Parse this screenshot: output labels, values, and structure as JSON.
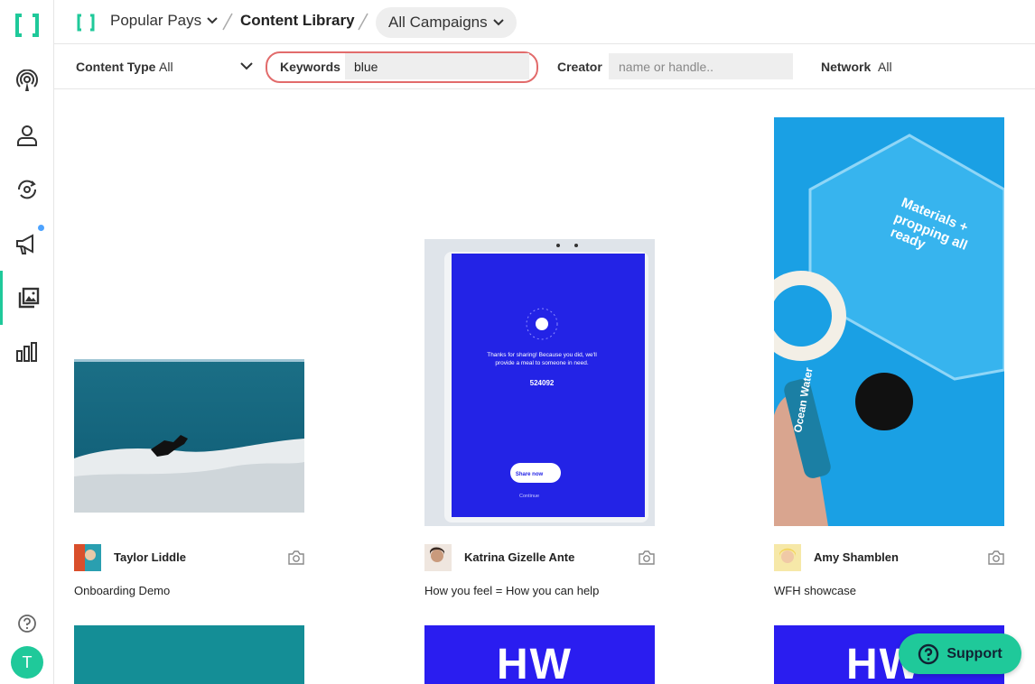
{
  "breadcrumb": {
    "org": "Popular Pays",
    "page": "Content Library",
    "campaign_filter": "All Campaigns"
  },
  "filters": {
    "content_type_label": "Content Type",
    "content_type_value": "All",
    "keywords_label": "Keywords",
    "keywords_value": "blue",
    "creator_label": "Creator",
    "creator_placeholder": "name or handle..",
    "network_label": "Network",
    "network_value": "All"
  },
  "sidebar": {
    "user_initial": "T",
    "notification_color": "#4da3ff"
  },
  "cards": [
    {
      "creator": "Taylor Liddle",
      "title": "Onboarding Demo",
      "media_type": "camera-icon"
    },
    {
      "creator": "Katrina Gizelle Ante",
      "title": "How you feel = How you can help",
      "media_type": "camera-icon"
    },
    {
      "creator": "Amy Shamblen",
      "title": "WFH showcase",
      "media_type": "camera-icon"
    }
  ],
  "media_text": {
    "tablet_message": "Thanks for sharing! Because you did, we'll provide a meal to someone in need.",
    "tablet_number": "524092",
    "tablet_button": "Share now",
    "tablet_continue": "Continue",
    "sign_text_1": "Materials +",
    "sign_text_2": "propping all",
    "sign_text_3": "ready",
    "bottle_text": "Ocean Water",
    "hw_text": "HW"
  },
  "support_label": "Support",
  "colors": {
    "brand": "#1fc99a",
    "highlight": "#e26b6b",
    "hw_blue": "#2a1df0"
  }
}
